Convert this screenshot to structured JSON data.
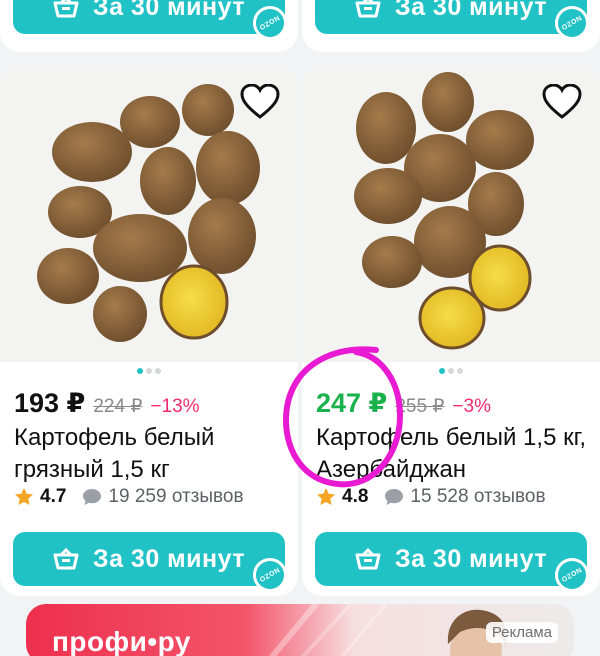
{
  "colors": {
    "accent": "#21c2c6",
    "price_green": "#18b14b",
    "discount": "#f2296d",
    "star": "#f5a623",
    "highlight_mark": "#e81bd3"
  },
  "top_buttons": [
    {
      "label": "За 30 минут",
      "badge": "OZON"
    },
    {
      "label": "За 30 минут",
      "badge": "OZON"
    }
  ],
  "products": [
    {
      "price": "193 ₽",
      "old_price": "224 ₽",
      "discount": "−13%",
      "title": "Картофель белый грязный 1,5 кг",
      "rating": "4.7",
      "reviews": "19 259 отзывов",
      "button_label": "За 30 минут",
      "badge": "OZON",
      "icons": {
        "favorite": "heart-icon",
        "cart": "basket-icon",
        "rating": "star-icon",
        "reviews": "chat-bubble-icon"
      }
    },
    {
      "price": "247 ₽",
      "old_price": "255 ₽",
      "discount": "−3%",
      "title": "Картофель белый 1,5 кг, Азербайджан",
      "rating": "4.8",
      "reviews": "15 528 отзывов",
      "button_label": "За 30 минут",
      "badge": "OZON",
      "icons": {
        "favorite": "heart-icon",
        "cart": "basket-icon",
        "rating": "star-icon",
        "reviews": "chat-bubble-icon"
      }
    }
  ],
  "ad_banner": {
    "logo": "профи•ру",
    "badge": "Реклама"
  }
}
